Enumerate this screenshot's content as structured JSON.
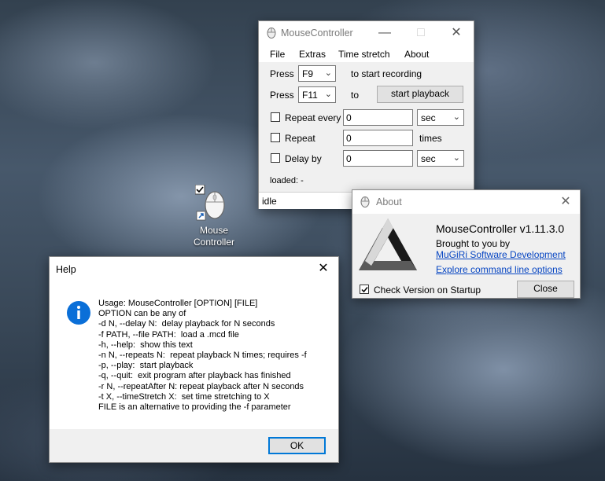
{
  "desktop": {
    "icon_label_line1": "Mouse",
    "icon_label_line2": "Controller"
  },
  "main_window": {
    "title": "MouseController",
    "menu": [
      "File",
      "Extras",
      "Time stretch",
      "About"
    ],
    "record_row": {
      "press_label": "Press",
      "key": "F9",
      "suffix": "to start recording"
    },
    "playback_row": {
      "press_label": "Press",
      "key": "F11",
      "to_label": "to",
      "button": "start playback"
    },
    "repeat_every": {
      "label": "Repeat every",
      "value": "0",
      "unit": "sec"
    },
    "repeat": {
      "label": "Repeat",
      "value": "0",
      "unit": "times"
    },
    "delay_by": {
      "label": "Delay by",
      "value": "0",
      "unit": "sec"
    },
    "loaded_text": "loaded:  -",
    "status": "idle"
  },
  "about_window": {
    "title": "About",
    "app_name": "MouseController v1.11.3.0",
    "brought_by": "Brought to you by",
    "company_link": "MuGiRi Software Development",
    "cmd_link": "Explore command line options",
    "check_label": "Check Version on Startup",
    "close_button": "Close"
  },
  "help_window": {
    "title": "Help",
    "lines": [
      "Usage: MouseController [OPTION] [FILE]",
      "OPTION can be any of",
      "-d N, --delay N:  delay playback for N seconds",
      "-f PATH, --file PATH:  load a .mcd file",
      "-h, --help:  show this text",
      "-n N, --repeats N:  repeat playback N times; requires -f",
      "-p, --play:  start playback",
      "-q, --quit:  exit program after playback has finished",
      "-r N, --repeatAfter N: repeat playback after N seconds",
      "-t X, --timeStretch X:  set time stretching to X",
      "FILE is an alternative to providing the -f parameter"
    ],
    "ok_button": "OK"
  },
  "colors": {
    "info_icon": "#0a6fd8",
    "link": "#0645c2",
    "default_button_border": "#0078d7"
  }
}
